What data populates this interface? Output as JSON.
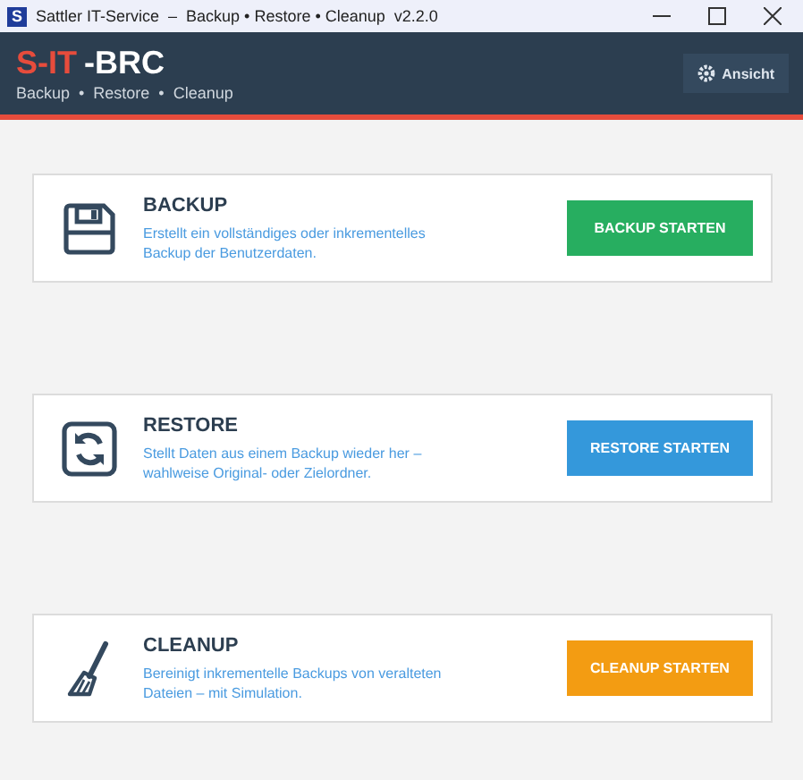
{
  "window": {
    "icon_text": "S",
    "title": "Sattler IT-Service  –  Backup • Restore • Cleanup  v2.2.0"
  },
  "header": {
    "logo_accent": "S-IT",
    "logo_main": "-BRC",
    "subtitle": "Backup  •  Restore  •  Cleanup",
    "view_button": "Ansicht"
  },
  "cards": [
    {
      "kind": "backup",
      "title": "BACKUP",
      "description": "Erstellt ein vollständiges oder inkrementelles Backup der Benutzerdaten.",
      "button": "BACKUP STARTEN",
      "color": "#27ae60"
    },
    {
      "kind": "restore",
      "title": "RESTORE",
      "description": "Stellt Daten aus einem Backup wieder her – wahlweise Original- oder Zielordner.",
      "button": "RESTORE STARTEN",
      "color": "#3498db"
    },
    {
      "kind": "cleanup",
      "title": "CLEANUP",
      "description": "Bereinigt inkrementelle Backups von veralteten Dateien – mit Simulation.",
      "button": "CLEANUP STARTEN",
      "color": "#f39c12"
    }
  ]
}
